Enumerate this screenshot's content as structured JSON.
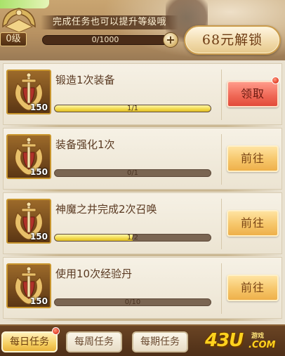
{
  "header": {
    "level_label": "0级",
    "hint": "完成任务也可以提升等级哦",
    "xp_text": "0/1000",
    "plus_label": "+",
    "unlock_label": "68元解锁"
  },
  "tasks": [
    {
      "title": "锻造1次装备",
      "reward_count": "150",
      "progress_text": "1/1",
      "progress": 1.0,
      "action": "领取",
      "state": "claim",
      "badge": true
    },
    {
      "title": "装备强化1次",
      "reward_count": "150",
      "progress_text": "0/1",
      "progress": 0.0,
      "action": "前往",
      "state": "go",
      "badge": false
    },
    {
      "title": "神魔之井完成2次召唤",
      "reward_count": "150",
      "progress_text": "1/2",
      "progress": 0.5,
      "action": "前往",
      "state": "go",
      "badge": false
    },
    {
      "title": "使用10次经验丹",
      "reward_count": "150",
      "progress_text": "0/10",
      "progress": 0.0,
      "action": "前往",
      "state": "go",
      "badge": false
    }
  ],
  "tabs": [
    {
      "label": "每日任务",
      "active": true,
      "badge": true
    },
    {
      "label": "每周任务",
      "active": false,
      "badge": false
    },
    {
      "label": "每期任务",
      "active": false,
      "badge": false
    }
  ],
  "logo": {
    "main": "43U",
    "small": "游戏",
    "suffix": ".COM"
  },
  "colors": {
    "claim": "#f06a58",
    "go": "#f6c66a",
    "progress_fill": "#f2d84a"
  }
}
